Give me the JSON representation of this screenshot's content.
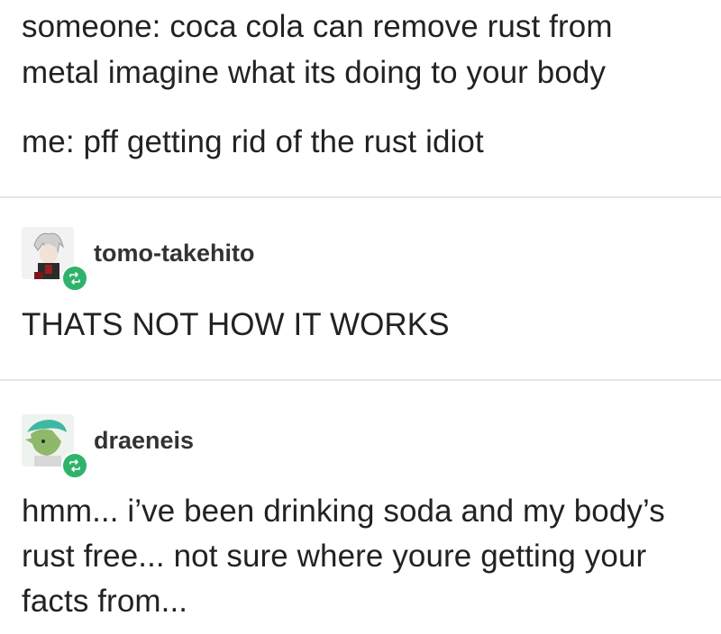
{
  "post": {
    "original_lines": [
      "someone: coca cola can remove rust from",
      "metal imagine what its doing to your body"
    ],
    "original_reply": "me: pff getting rid of the rust idiot"
  },
  "reblogs": [
    {
      "username": "tomo-takehito",
      "text": "THATS NOT HOW IT WORKS"
    },
    {
      "username": "draeneis",
      "text_lines": [
        "hmm... i’ve been drinking soda and my body’s",
        "rust free... not sure where youre getting your",
        "facts from..."
      ]
    }
  ],
  "colors": {
    "text": "#222222",
    "divider": "#e5e5e5",
    "reblog_badge": "#2fb36b"
  },
  "icons": {
    "reblog": "reblog-icon",
    "avatar1": "avatar-tomo-takehito",
    "avatar2": "avatar-draeneis"
  }
}
